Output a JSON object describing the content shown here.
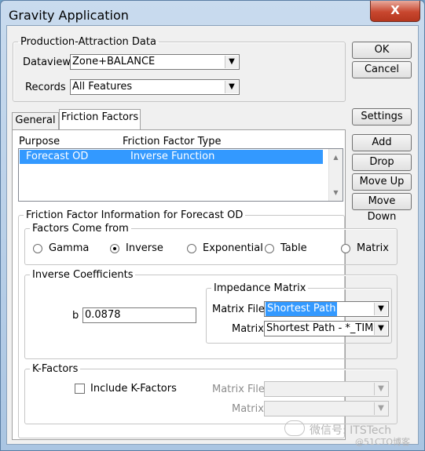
{
  "window": {
    "title": "Gravity Application",
    "close_label": "X"
  },
  "buttons": {
    "ok": "OK",
    "cancel": "Cancel",
    "settings": "Settings",
    "add": "Add",
    "drop": "Drop",
    "move_up": "Move Up",
    "move_down": "Move Down"
  },
  "prod_attr": {
    "legend": "Production-Attraction Data",
    "dataview_label": "Dataview",
    "dataview_value": "Zone+BALANCE",
    "records_label": "Records",
    "records_value": "All Features"
  },
  "tabs": [
    {
      "label": "General"
    },
    {
      "label": "Friction Factors"
    }
  ],
  "purpose_list": {
    "col_purpose": "Purpose",
    "col_type": "Friction Factor Type",
    "rows": [
      {
        "purpose": "Forecast OD",
        "type": "Inverse Function"
      }
    ]
  },
  "ff_info": {
    "legend": "Friction Factor Information for Forecast OD",
    "factors_legend": "Factors Come from",
    "options": [
      "Gamma",
      "Inverse",
      "Exponential",
      "Table",
      "Matrix"
    ],
    "selected": "Inverse",
    "inverse_legend": "Inverse Coefficients",
    "b_label": "b",
    "b_value": "0.0878",
    "impedance_legend": "Impedance Matrix",
    "matrix_file_label": "Matrix File",
    "matrix_file_value": "Shortest Path",
    "matrix_label": "Matrix",
    "matrix_value": "Shortest Path - *_TIME"
  },
  "kfactors": {
    "legend": "K-Factors",
    "include_label": "Include K-Factors",
    "matrix_file_label": "Matrix File",
    "matrix_label": "Matrix"
  },
  "watermark": "微信号: ITSTech",
  "watermark2": "@51CTO博客"
}
